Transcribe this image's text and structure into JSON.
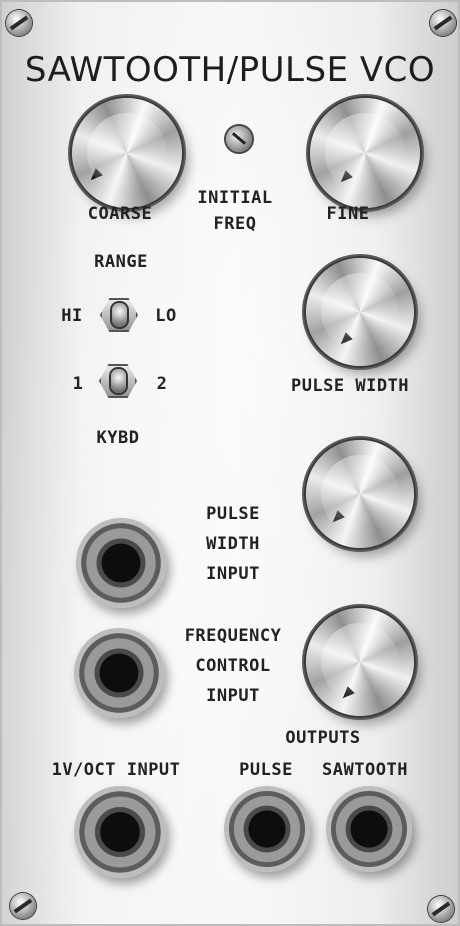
{
  "panel": {
    "title": "SAWTOOTH/PULSE VCO",
    "knobs": {
      "coarse_label": "COARSE",
      "fine_label": "FINE",
      "pulse_width_label": "PULSE  WIDTH"
    },
    "trimpot": {
      "label_line1": "INITIAL",
      "label_line2": "FREQ"
    },
    "range_switch": {
      "label": "RANGE",
      "left": "HI",
      "right": "LO"
    },
    "kybd_switch": {
      "left": "1",
      "right": "2",
      "label": "KYBD"
    },
    "jack_labels": {
      "pw_input_line1": "PULSE",
      "pw_input_line2": "WIDTH",
      "pw_input_line3": "INPUT",
      "fc_input_line1": "FREQUENCY",
      "fc_input_line2": "CONTROL",
      "fc_input_line3": "INPUT",
      "v_oct_input": "1V/OCT  INPUT",
      "outputs": "OUTPUTS",
      "pulse": "PULSE",
      "sawtooth": "SAWTOOTH"
    }
  },
  "colors": {
    "panel": "#f2f2f2",
    "text": "#1a1a1a",
    "metal": "#9a9a9a"
  }
}
